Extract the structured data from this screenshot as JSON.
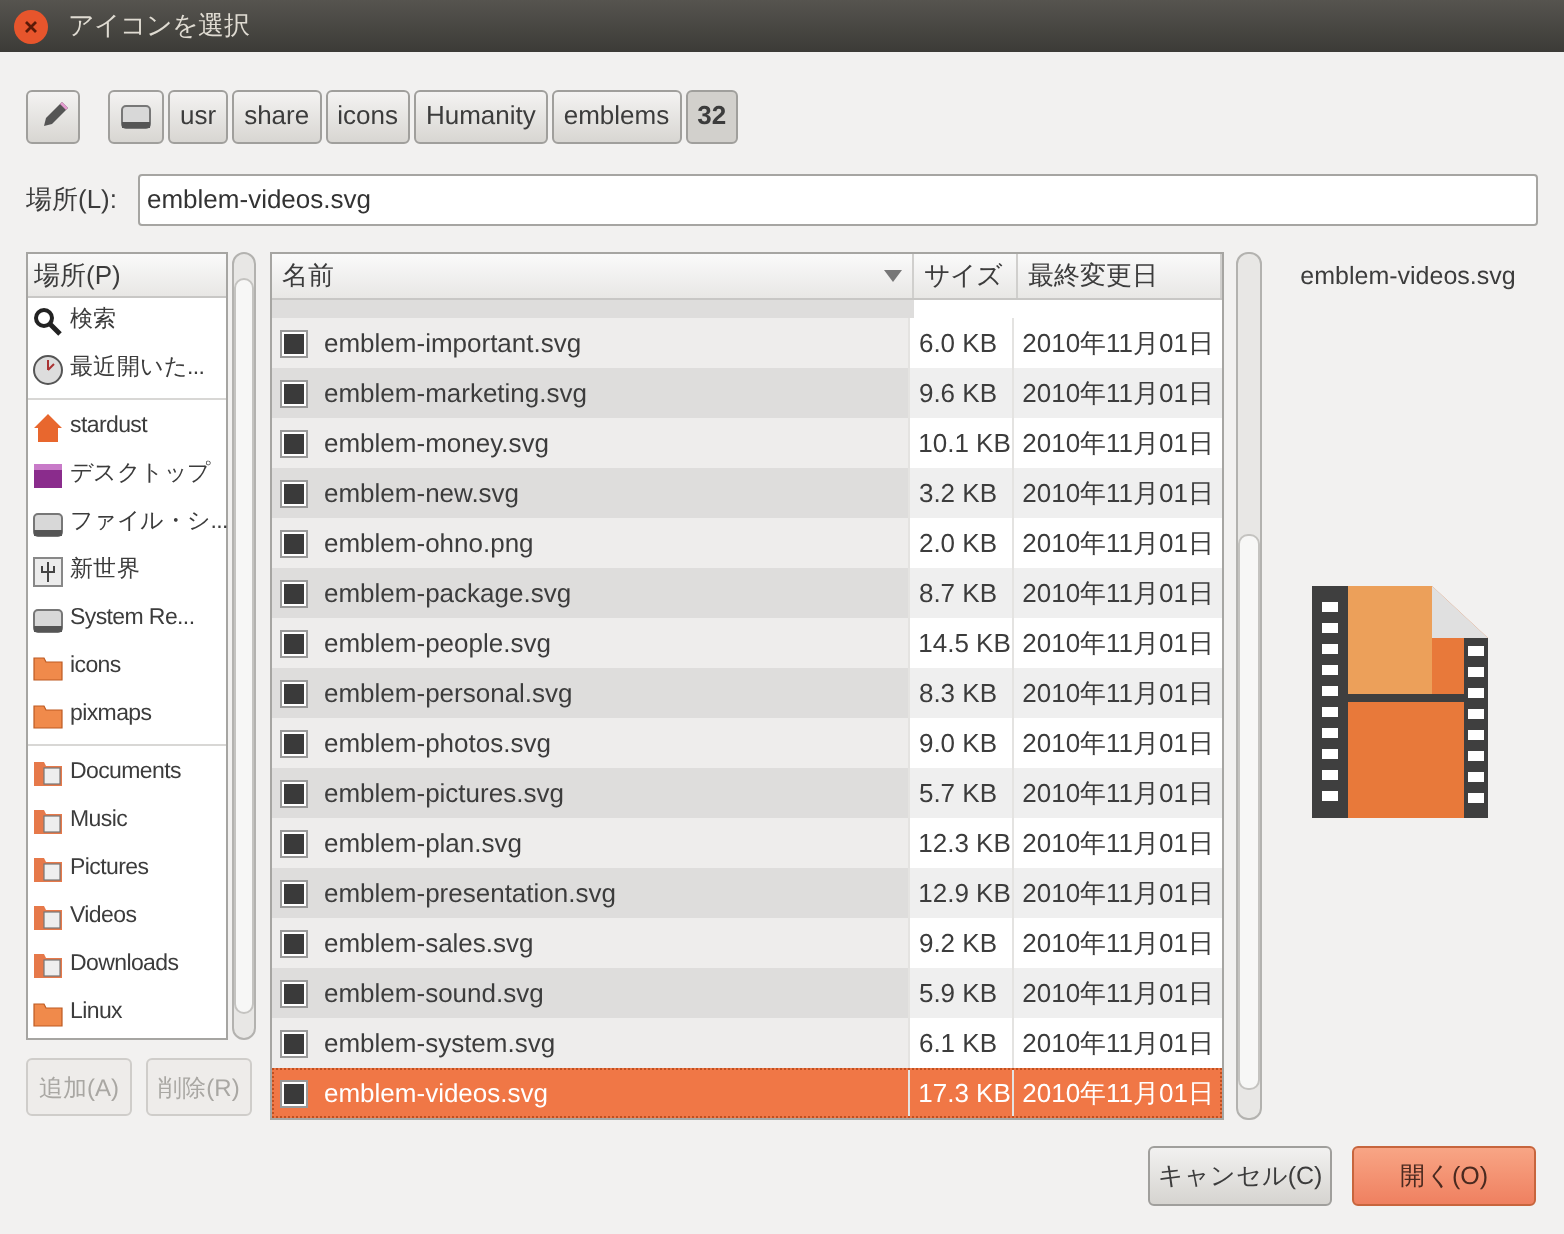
{
  "window": {
    "title": "アイコンを選択"
  },
  "path_bar": {
    "edit_toggle": {
      "selected": false
    },
    "segments": [
      {
        "kind": "drive",
        "selected": false
      },
      {
        "kind": "text",
        "label": "usr",
        "selected": false
      },
      {
        "kind": "text",
        "label": "share",
        "selected": false
      },
      {
        "kind": "text",
        "label": "icons",
        "selected": false
      },
      {
        "kind": "text",
        "label": "Humanity",
        "selected": false
      },
      {
        "kind": "text",
        "label": "emblems",
        "selected": false
      },
      {
        "kind": "text",
        "label": "32",
        "selected": true
      }
    ]
  },
  "location": {
    "label": "場所(L):",
    "value": "emblem-videos.svg"
  },
  "places": {
    "header": "場所(P)",
    "groups": [
      [
        {
          "kind": "search",
          "label": "検索"
        },
        {
          "kind": "recent",
          "label": "最近開いた..."
        }
      ],
      [
        {
          "kind": "home",
          "label": "stardust"
        },
        {
          "kind": "desktop",
          "label": "デスクトップ"
        },
        {
          "kind": "drive",
          "label": "ファイル・シ..."
        },
        {
          "kind": "usb",
          "label": "新世界"
        },
        {
          "kind": "drive",
          "label": "System Re..."
        },
        {
          "kind": "folder",
          "label": "icons"
        },
        {
          "kind": "folder",
          "label": "pixmaps"
        }
      ],
      [
        {
          "kind": "documents",
          "label": "Documents"
        },
        {
          "kind": "music",
          "label": "Music"
        },
        {
          "kind": "pictures",
          "label": "Pictures"
        },
        {
          "kind": "videos",
          "label": "Videos"
        },
        {
          "kind": "downloads",
          "label": "Downloads"
        },
        {
          "kind": "folder",
          "label": "Linux"
        }
      ]
    ],
    "buttons": [
      {
        "label": "追加(A)",
        "disabled": true
      },
      {
        "label": "削除(R)",
        "disabled": true
      }
    ]
  },
  "table": {
    "columns": [
      {
        "label": "名前",
        "sorted": true
      },
      {
        "label": "サイズ",
        "sorted": false
      },
      {
        "label": "最終変更日",
        "sorted": false
      }
    ],
    "rows": [
      {
        "name": "emblem-important.svg",
        "size": "6.0 KB",
        "date": "2010年11月01日",
        "selected": false
      },
      {
        "name": "emblem-marketing.svg",
        "size": "9.6 KB",
        "date": "2010年11月01日",
        "selected": false
      },
      {
        "name": "emblem-money.svg",
        "size": "10.1 KB",
        "date": "2010年11月01日",
        "selected": false
      },
      {
        "name": "emblem-new.svg",
        "size": "3.2 KB",
        "date": "2010年11月01日",
        "selected": false
      },
      {
        "name": "emblem-ohno.png",
        "size": "2.0 KB",
        "date": "2010年11月01日",
        "selected": false
      },
      {
        "name": "emblem-package.svg",
        "size": "8.7 KB",
        "date": "2010年11月01日",
        "selected": false
      },
      {
        "name": "emblem-people.svg",
        "size": "14.5 KB",
        "date": "2010年11月01日",
        "selected": false
      },
      {
        "name": "emblem-personal.svg",
        "size": "8.3 KB",
        "date": "2010年11月01日",
        "selected": false
      },
      {
        "name": "emblem-photos.svg",
        "size": "9.0 KB",
        "date": "2010年11月01日",
        "selected": false
      },
      {
        "name": "emblem-pictures.svg",
        "size": "5.7 KB",
        "date": "2010年11月01日",
        "selected": false
      },
      {
        "name": "emblem-plan.svg",
        "size": "12.3 KB",
        "date": "2010年11月01日",
        "selected": false
      },
      {
        "name": "emblem-presentation.svg",
        "size": "12.9 KB",
        "date": "2010年11月01日",
        "selected": false
      },
      {
        "name": "emblem-sales.svg",
        "size": "9.2 KB",
        "date": "2010年11月01日",
        "selected": false
      },
      {
        "name": "emblem-sound.svg",
        "size": "5.9 KB",
        "date": "2010年11月01日",
        "selected": false
      },
      {
        "name": "emblem-system.svg",
        "size": "6.1 KB",
        "date": "2010年11月01日",
        "selected": false
      },
      {
        "name": "emblem-videos.svg",
        "size": "17.3 KB",
        "date": "2010年11月01日",
        "selected": true
      }
    ]
  },
  "preview": {
    "filename": "emblem-videos.svg"
  },
  "dialog_buttons": [
    {
      "label": "キャンセル(C)",
      "kind": "cancel"
    },
    {
      "label": "開く(O)",
      "kind": "default"
    }
  ]
}
